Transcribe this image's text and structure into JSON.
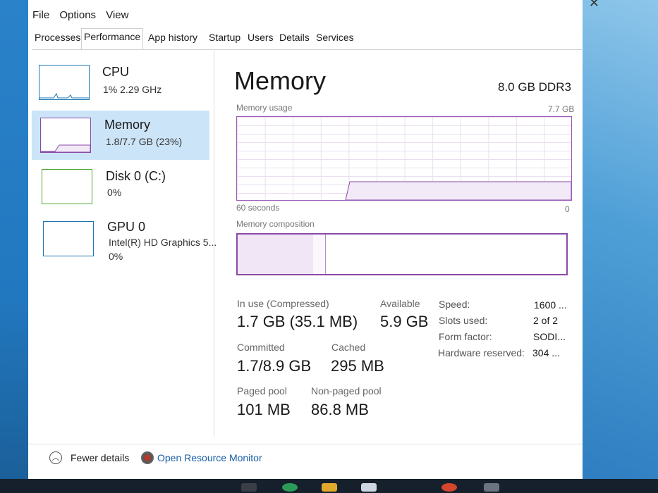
{
  "menu": [
    "File",
    "Options",
    "View"
  ],
  "tabs": [
    "Processes",
    "Performance",
    "App history",
    "Startup",
    "Users",
    "Details",
    "Services"
  ],
  "active_tab": "Performance",
  "sidebar": {
    "items": [
      {
        "title": "CPU",
        "sub1": "1% 2.29 GHz",
        "sub2": "",
        "color": "#1a76b4"
      },
      {
        "title": "Memory",
        "sub1": "1.8/7.7 GB (23%)",
        "sub2": "",
        "color": "#8a4aa9"
      },
      {
        "title": "Disk 0 (C:)",
        "sub1": "0%",
        "sub2": "",
        "color": "#4ea72e"
      },
      {
        "title": "GPU 0",
        "sub1": "Intel(R) HD Graphics 5...",
        "sub2": "0%",
        "color": "#1a76b4"
      }
    ]
  },
  "main": {
    "title": "Memory",
    "spec": "8.0 GB DDR3",
    "usage_label": "Memory usage",
    "usage_max": "7.7 GB",
    "time_label": "60 seconds",
    "time_end": "0",
    "composition_label": "Memory composition"
  },
  "stats": {
    "in_use_label": "In use (Compressed)",
    "in_use_value": "1.7 GB (35.1 MB)",
    "available_label": "Available",
    "available_value": "5.9 GB",
    "committed_label": "Committed",
    "committed_value": "1.7/8.9 GB",
    "cached_label": "Cached",
    "cached_value": "295 MB",
    "paged_label": "Paged pool",
    "paged_value": "101 MB",
    "nonpaged_label": "Non-paged pool",
    "nonpaged_value": "86.8 MB"
  },
  "details": [
    {
      "label": "Speed:",
      "value": "1600 ..."
    },
    {
      "label": "Slots used:",
      "value": "2 of 2"
    },
    {
      "label": "Form factor:",
      "value": "SODI..."
    },
    {
      "label": "Hardware reserved:",
      "value": "304 ..."
    }
  ],
  "footer": {
    "fewer_details": "Fewer details",
    "open_monitor": "Open Resource Monitor"
  },
  "colors": {
    "memory": "#8a4aa9",
    "selected": "#cce4f7",
    "link": "#1a5fa8"
  }
}
